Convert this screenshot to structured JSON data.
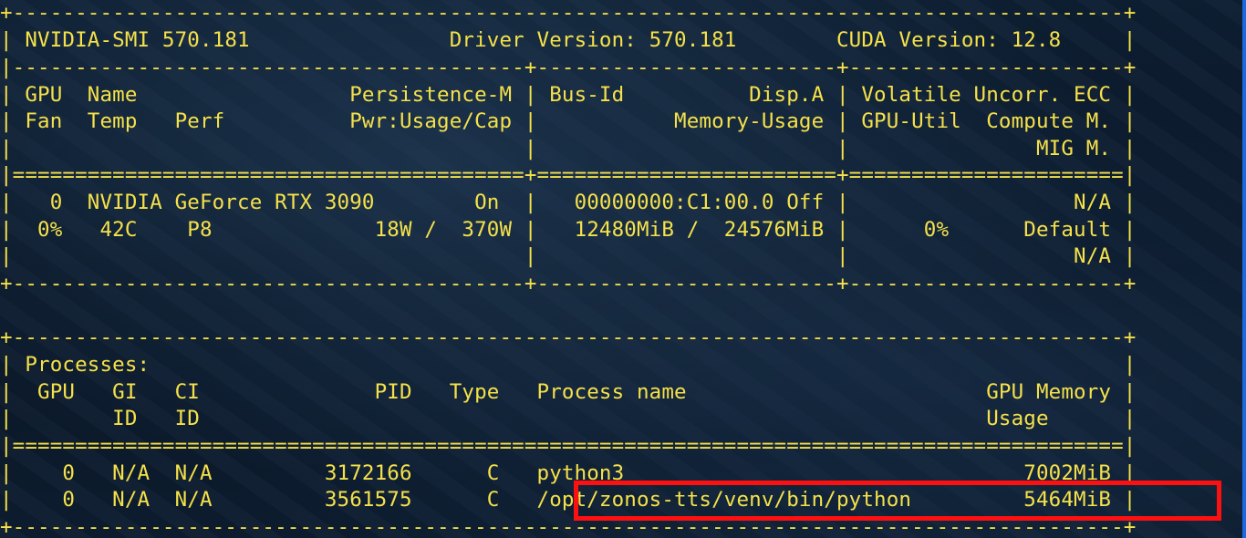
{
  "lines": [
    "+-----------------------------------------------------------------------------------------+",
    "| NVIDIA-SMI 570.181                Driver Version: 570.181        CUDA Version: 12.8     |",
    "|-----------------------------------------+------------------------+----------------------+",
    "| GPU  Name                 Persistence-M | Bus-Id          Disp.A | Volatile Uncorr. ECC |",
    "| Fan  Temp   Perf          Pwr:Usage/Cap |           Memory-Usage | GPU-Util  Compute M. |",
    "|                                         |                        |               MIG M. |",
    "|=========================================+========================+======================|",
    "|   0  NVIDIA GeForce RTX 3090        On  |   00000000:C1:00.0 Off |                  N/A |",
    "|  0%   42C    P8             18W /  370W |   12480MiB /  24576MiB |      0%      Default |",
    "|                                         |                        |                  N/A |",
    "+-----------------------------------------+------------------------+----------------------+",
    "",
    "+-----------------------------------------------------------------------------------------+",
    "| Processes:                                                                              |",
    "|  GPU   GI   CI              PID   Type   Process name                        GPU Memory |",
    "|        ID   ID                                                               Usage      |",
    "|=========================================================================================|",
    "|    0   N/A  N/A         3172166      C   python3                                7002MiB |",
    "|    0   N/A  N/A         3561575      C   /opt/zonos-tts/venv/bin/python         5464MiB |",
    "+-----------------------------------------------------------------------------------------+"
  ],
  "colors": {
    "text": "#f5e14a",
    "highlight": "#ff1010",
    "scrollbar": "#1b6ae0"
  }
}
